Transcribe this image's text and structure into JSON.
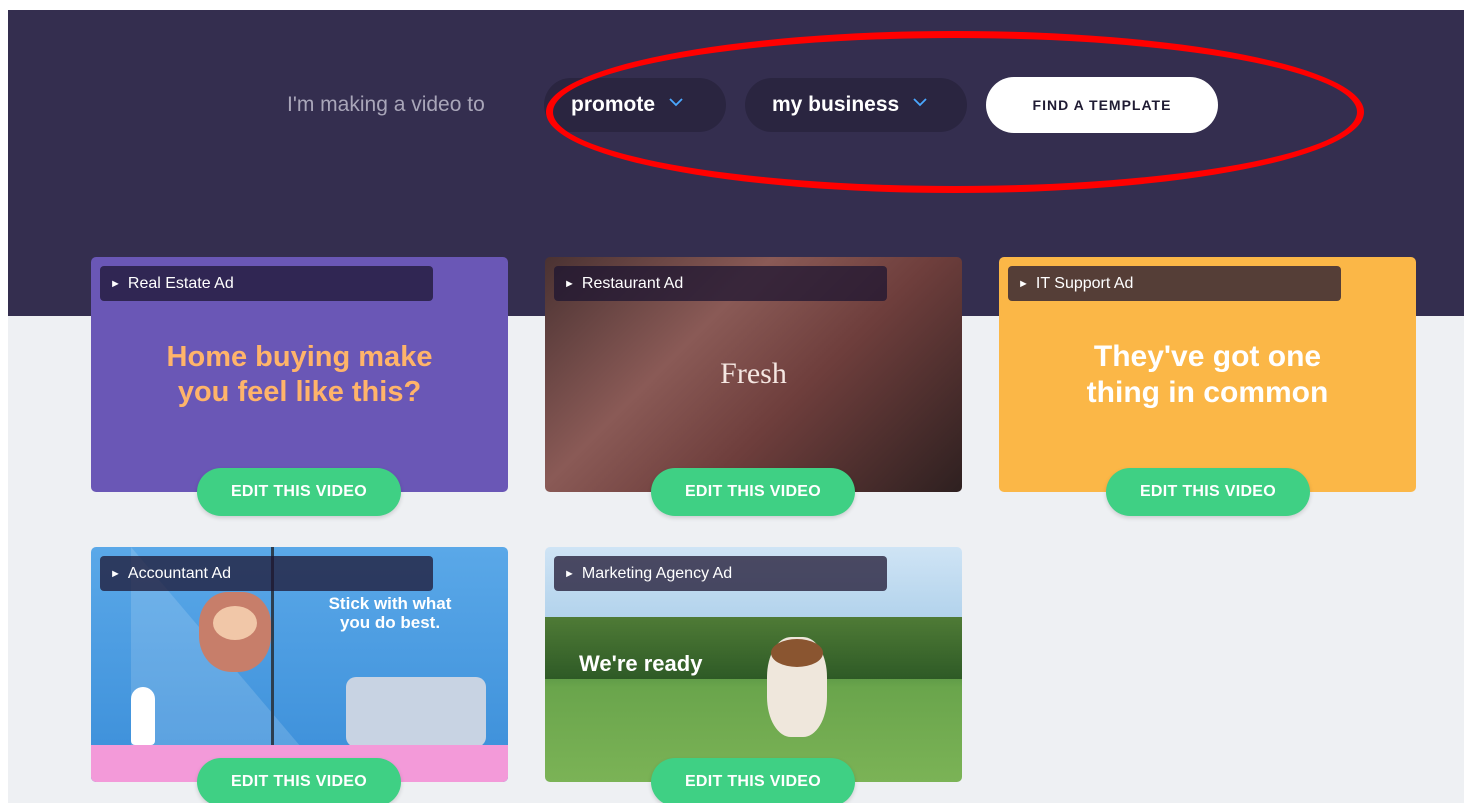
{
  "hero": {
    "prompt": "I'm making a video to",
    "purpose_dropdown": {
      "selected": "promote"
    },
    "subject_dropdown": {
      "selected": "my business"
    },
    "find_button": "FIND A TEMPLATE",
    "colors": {
      "background": "#342e4f",
      "dropdown": "#2a2540",
      "highlight_ring": "#ff0000"
    }
  },
  "templates": [
    {
      "title": "Real Estate Ad",
      "headline": "Home buying make\nyou feel like this?",
      "button": "EDIT THIS VIDEO"
    },
    {
      "title": "Restaurant Ad",
      "headline": "Fresh",
      "button": "EDIT THIS VIDEO"
    },
    {
      "title": "IT Support Ad",
      "headline": "They've got one\nthing in common",
      "button": "EDIT THIS VIDEO"
    },
    {
      "title": "Accountant Ad",
      "headline": "Stick with what\nyou do best.",
      "button": "EDIT THIS VIDEO"
    },
    {
      "title": "Marketing Agency Ad",
      "headline": "We're ready",
      "button": "EDIT THIS VIDEO"
    }
  ],
  "colors": {
    "edit_button": "#3fd084",
    "page_background": "#eef0f3"
  }
}
